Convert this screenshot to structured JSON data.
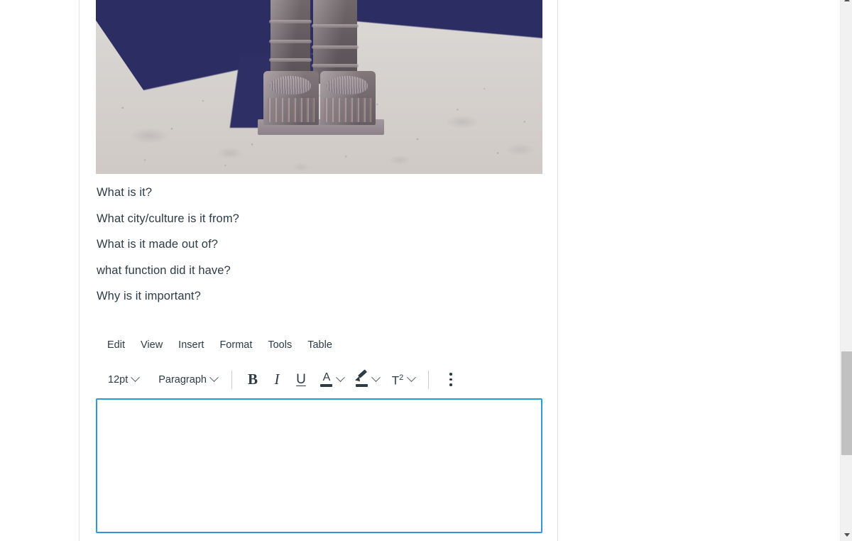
{
  "question": {
    "image_alt": "Stone statue feet on sandy ground with deep blue shadow",
    "prompts": [
      "What is it?",
      "What city/culture is it from?",
      "What is it made out of?",
      "what function did it have?",
      "Why is it important?"
    ]
  },
  "editor": {
    "menu": [
      {
        "label": "Edit",
        "name": "menu-edit"
      },
      {
        "label": "View",
        "name": "menu-view"
      },
      {
        "label": "Insert",
        "name": "menu-insert"
      },
      {
        "label": "Format",
        "name": "menu-format"
      },
      {
        "label": "Tools",
        "name": "menu-tools"
      },
      {
        "label": "Table",
        "name": "menu-table"
      }
    ],
    "toolbar": {
      "font_size": "12pt",
      "block_format": "Paragraph",
      "bold": "B",
      "italic": "I",
      "underline": "U",
      "text_color_glyph": "A",
      "superscript_glyph": "T",
      "superscript_exponent": "2",
      "more_label": "⋮"
    },
    "body_value": "",
    "body_placeholder": "",
    "focus_color": "#2f97de"
  },
  "colors": {
    "text": "#2d3b45",
    "border": "#e3e5e7",
    "scrollbar_track": "#f1f1f1",
    "scrollbar_thumb": "#c1c1c1",
    "shadow_blue": "#2c2d63"
  }
}
